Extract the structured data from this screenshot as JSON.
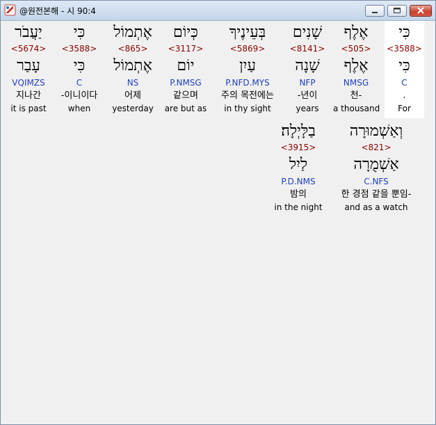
{
  "window": {
    "title": "@원전본해 - 시 90:4"
  },
  "words": [
    {
      "heb": "כִּי",
      "strong": "<3588>",
      "lemma": "כִּי",
      "parse": "C",
      "kor": ".",
      "eng": "For"
    },
    {
      "heb": "אֶלֶף",
      "strong": "<505>",
      "lemma": "אֶלֶף",
      "parse": "NMSG",
      "kor": "천-",
      "eng": "a thousand"
    },
    {
      "heb": "שָׁנִים",
      "strong": "<8141>",
      "lemma": "שָׁנָה",
      "parse": "NFP",
      "kor": "-년이",
      "eng": "years"
    },
    {
      "heb": "בְּעֵינֶיךָ",
      "strong": "<5869>",
      "lemma": "עַיִן",
      "parse": "P.NFD.MYS",
      "kor": "주의 목전에는",
      "eng": "in thy sight"
    },
    {
      "heb": "כְּיוֹם",
      "strong": "<3117>",
      "lemma": "יוֹם",
      "parse": "P.NMSG",
      "kor": "같으며",
      "eng": "are but as"
    },
    {
      "heb": "אֶתְמוֹל",
      "strong": "<865>",
      "lemma": "אֶתְמוֹל",
      "parse": "NS",
      "kor": "어제",
      "eng": "yesterday"
    },
    {
      "heb": "כִּי",
      "strong": "<3588>",
      "lemma": "כִּי",
      "parse": "C",
      "kor": "-이니이다",
      "eng": "when"
    },
    {
      "heb": "יַעֲבֹר",
      "strong": "<5674>",
      "lemma": "עָבַר",
      "parse": "VQIMZS",
      "kor": "지나간",
      "eng": "it is past"
    },
    {
      "heb": "וְאַשְׁמוּרָה",
      "strong": "<821>",
      "lemma": "אַשְׁמֻרָה",
      "parse": "C.NFS",
      "kor": "한 경점 같을 뿐임-",
      "eng": "and as a watch"
    },
    {
      "heb": "בַלָּיְלָה׃",
      "strong": "<3915>",
      "lemma": "לַיִל",
      "parse": "P.D.NMS",
      "kor": "밤의",
      "eng": "in the night"
    }
  ]
}
